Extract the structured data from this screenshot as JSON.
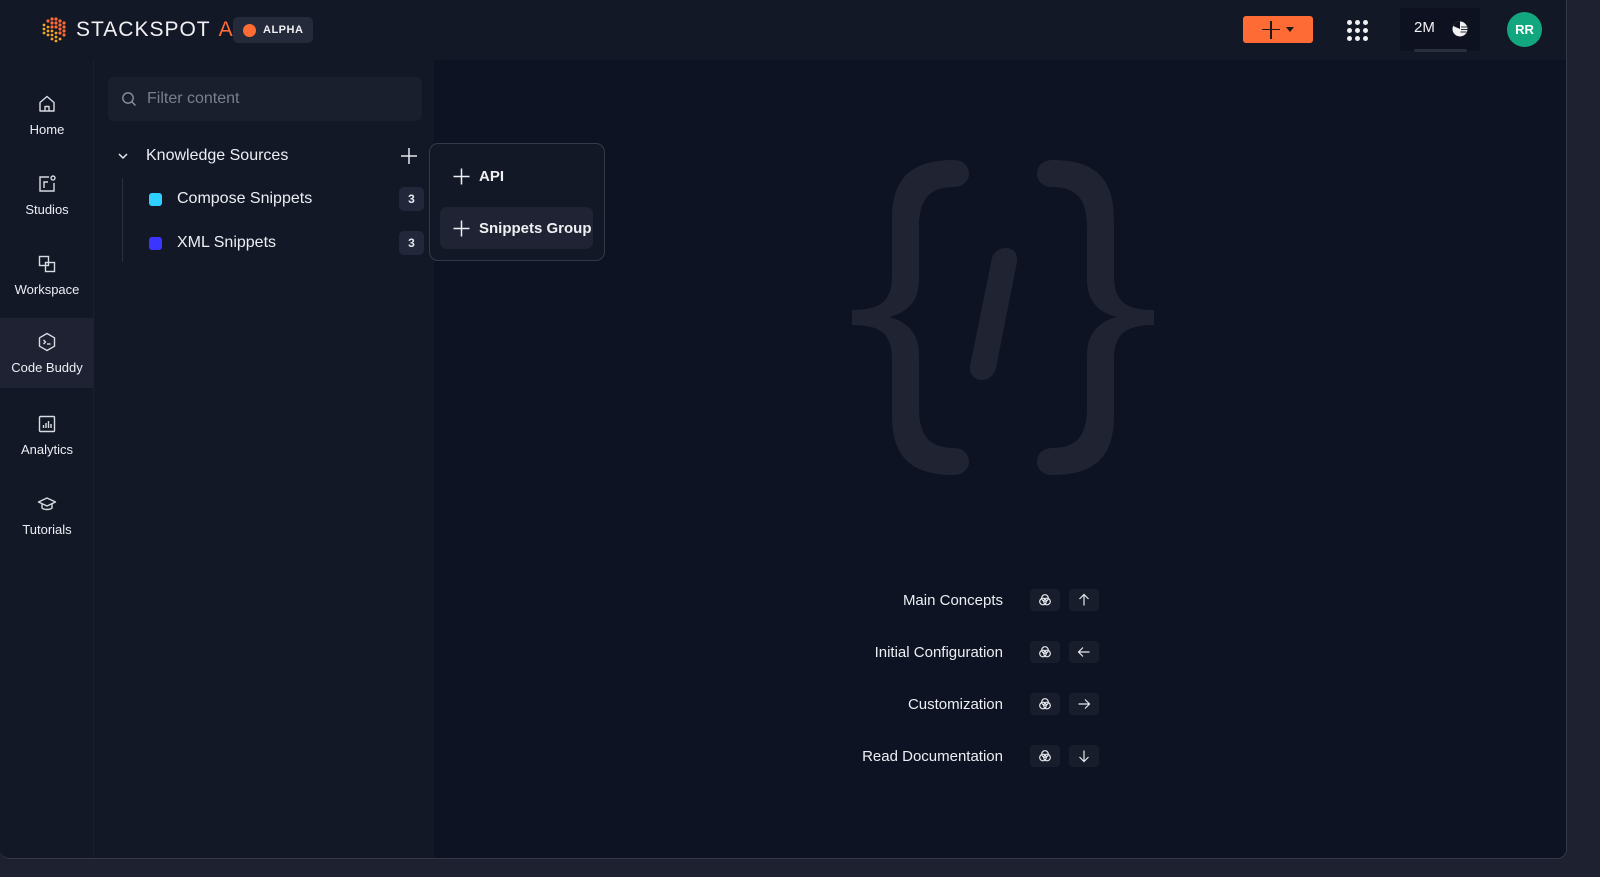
{
  "header": {
    "brand": "STACKSPOT",
    "brand_suffix": "AI",
    "badge": "ALPHA",
    "credits_value": "2M",
    "avatar_initials": "RR"
  },
  "colors": {
    "accent": "#ff6b35",
    "avatar": "#12a77e",
    "compose_snippets": "#2ed0ff",
    "xml_snippets": "#3a35ff"
  },
  "nav": {
    "items": [
      {
        "label": "Home",
        "icon": "home-icon"
      },
      {
        "label": "Studios",
        "icon": "studios-icon"
      },
      {
        "label": "Workspace",
        "icon": "workspace-icon"
      },
      {
        "label": "Code Buddy",
        "icon": "code-buddy-icon",
        "active": true
      },
      {
        "label": "Analytics",
        "icon": "analytics-icon"
      },
      {
        "label": "Tutorials",
        "icon": "graduation-cap-icon"
      }
    ]
  },
  "sidebar": {
    "filter_placeholder": "Filter content",
    "section_title": "Knowledge Sources",
    "items": [
      {
        "name": "Compose Snippets",
        "count": "3"
      },
      {
        "name": "XML Snippets",
        "count": "3"
      }
    ]
  },
  "popup": {
    "items": [
      {
        "label": "API"
      },
      {
        "label": "Snippets Group"
      }
    ]
  },
  "main": {
    "shortcuts": [
      {
        "label": "Main Concepts",
        "key_icon": "shortcut-modifier-icon",
        "arrow": "arrow-up-icon"
      },
      {
        "label": "Initial Configuration",
        "key_icon": "shortcut-modifier-icon",
        "arrow": "arrow-left-icon"
      },
      {
        "label": "Customization",
        "key_icon": "shortcut-modifier-icon",
        "arrow": "arrow-right-icon"
      },
      {
        "label": "Read Documentation",
        "key_icon": "shortcut-modifier-icon",
        "arrow": "arrow-down-icon"
      }
    ]
  }
}
